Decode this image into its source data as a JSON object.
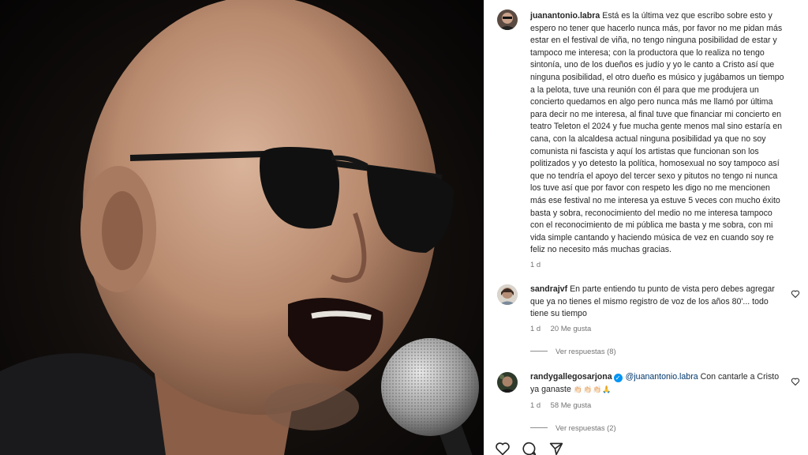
{
  "post": {
    "author": "juanantonio.labra",
    "caption": "Está es la última vez que escribo sobre esto y espero no tener que hacerlo nunca más, por favor no me pidan más estar en el festival de viña, no tengo ninguna posibilidad de estar y tampoco me interesa; con la productora que lo realiza no tengo sintonía, uno de los dueños es judío y yo le canto a Cristo así que ninguna posibilidad, el otro dueño es músico y jugábamos un tiempo a la pelota, tuve una reunión con él para que me produjera un concierto quedamos en algo pero nunca más me llamó por última para decir no me interesa, al final tuve que financiar mi concierto en teatro Teleton el 2024 y fue mucha gente menos mal sino estaría en cana, con la alcaldesa actual ninguna posibilidad ya que no soy comunista ni fascista y aquí los artistas que funcionan son los politizados y yo detesto la política, homosexual no soy tampoco así que no tendría el apoyo del tercer sexo y pitutos no tengo ni nunca los tuve así que por favor con respeto les digo no me mencionen más ese festival no me interesa ya estuve 5 veces con mucho éxito basta y sobra, reconocimiento del medio no me interesa tampoco con el reconocimiento de mi pública me basta y me sobra, con mi vida simple cantando y haciendo música de vez en cuando soy re feliz no necesito más muchas gracias.",
    "time": "1 d"
  },
  "comments": [
    {
      "username": "sandrajvf",
      "text": "En parte entiendo tu punto de vista pero debes agregar que ya no tienes el mismo registro de voz de los años 80'... todo tiene su tiempo",
      "time": "1 d",
      "likes": "20 Me gusta",
      "replies": "Ver respuestas (8)"
    },
    {
      "username": "randygallegosarjona",
      "mention": "@juanantonio.labra",
      "text": "Con cantarle a Cristo ya ganaste",
      "emojis": "👏🏻👏🏻👏🏻🙏",
      "time": "1 d",
      "likes": "58 Me gusta",
      "replies": "Ver respuestas (2)"
    }
  ],
  "icons": {
    "like": "heart-icon",
    "comment": "comment-icon",
    "share": "share-icon",
    "verified": "verified-badge-icon"
  },
  "colors": {
    "panel_bg": "#ffffff",
    "text": "#262626",
    "secondary": "#737373",
    "mention": "#00376b",
    "verified": "#0095f6"
  }
}
